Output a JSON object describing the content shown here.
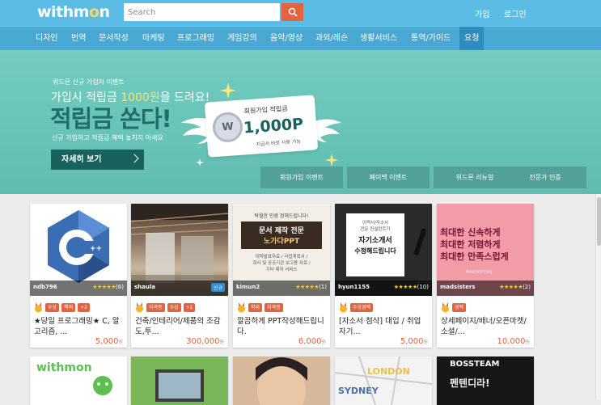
{
  "brand": {
    "logo_text_a": "withm",
    "logo_text_o": "o",
    "logo_text_b": "n"
  },
  "search": {
    "placeholder": "Search",
    "value": ""
  },
  "header": {
    "login": "가입",
    "signup": "로그인"
  },
  "nav": [
    "디자인",
    "번역",
    "문서작성",
    "마케팅",
    "프로그래밍",
    "게임강의",
    "음악/영상",
    "과외/레슨",
    "생활서비스",
    "통역/가이드",
    "요청"
  ],
  "nav_active_index": 10,
  "banner": {
    "event_label": "위드몬 신규 가입자 이벤트",
    "line_before": "가입시 적립금 ",
    "line_highlight": "1000원",
    "line_after": "을 드려요!",
    "headline": "적립금 쏜다!",
    "note": "신규 가입하고 적립금 혜택 놓치지 마세요",
    "cta": "자세히 보기",
    "card_title": "회원가입 적립금",
    "card_amount": "1,000P",
    "card_sub": "지급서 바로 사용 가능",
    "coin_letter": "W",
    "tabs": [
      "회원가입 이벤트",
      "페이백 이벤트",
      "위드몬 리뉴얼",
      "전문가 인증"
    ]
  },
  "colors": {
    "header": "#5bbde6",
    "nav": "#4aa9d3",
    "banner": "#6cc5b9",
    "accent": "#e2633d",
    "dark_teal": "#17625c"
  },
  "cards": [
    {
      "seller": "ndb796",
      "stars": "★★★★★",
      "reviews": "(6)",
      "tags": [
        "수상",
        "책퍼",
        "+2"
      ],
      "title": "★당일 프로그래밍★ C, 알고리즘, ...",
      "price": "5,000",
      "unit": "원",
      "thumb": "cpp-logo"
    },
    {
      "seller": "shaula",
      "stars": "",
      "reviews": "",
      "new_badge": "신규",
      "tags": [
        "자격증",
        "수상",
        "+1"
      ],
      "title": "건축/인테리어/제품의 조감도,투...",
      "price": "300,000",
      "unit": "원",
      "thumb": "interior-photo"
    },
    {
      "seller": "kimun2",
      "stars": "★★★★★",
      "reviews": "(1)",
      "tags": [
        "학위",
        "자격증"
      ],
      "title": "깔끔하게 PPT작성해드립니다.",
      "price": "6,000",
      "unit": "원",
      "thumb": "doc-ppt",
      "thumb_lines": [
        "탁월한 만큼 정해드립니다!",
        "문서 제작 전문",
        "노가다PPT",
        "대학발표자료 / 사업계획서 /",
        "회사 및 공공기관 보고용 자료 /",
        "기타 제작 서비스"
      ]
    },
    {
      "seller": "hyun1155",
      "stars": "★★★★★",
      "reviews": "(10)",
      "tags": [
        "수상경력"
      ],
      "title": "[자소서 첨삭] 대입 / 취업 자기...",
      "price": "5,000",
      "unit": "원",
      "thumb": "resume",
      "thumb_lines": [
        "이력서/자소서",
        "전문 컨설턴트가",
        "자기소개서",
        "수정해드립니다"
      ]
    },
    {
      "seller": "madsisters",
      "stars": "★★★★★",
      "reviews": "(2)",
      "tags": [
        "경력"
      ],
      "title": "상세페이지/배너/오픈마켓/소셜/...",
      "price": "10,000",
      "unit": "원",
      "thumb": "pink-ad",
      "thumb_lines": [
        "최대한 신속하게",
        "최대한 저렴하게",
        "최대한 만족스럽게"
      ],
      "thumb_watermark": "MADSISTERS"
    }
  ],
  "row2_thumbs": [
    {
      "label": "withmon"
    },
    {
      "label": ""
    },
    {
      "label": ""
    },
    {
      "label": "LONDON",
      "label2": "SYDNEY"
    },
    {
      "label": "BOSSTEAM",
      "label2": "펜텐디라!"
    }
  ]
}
